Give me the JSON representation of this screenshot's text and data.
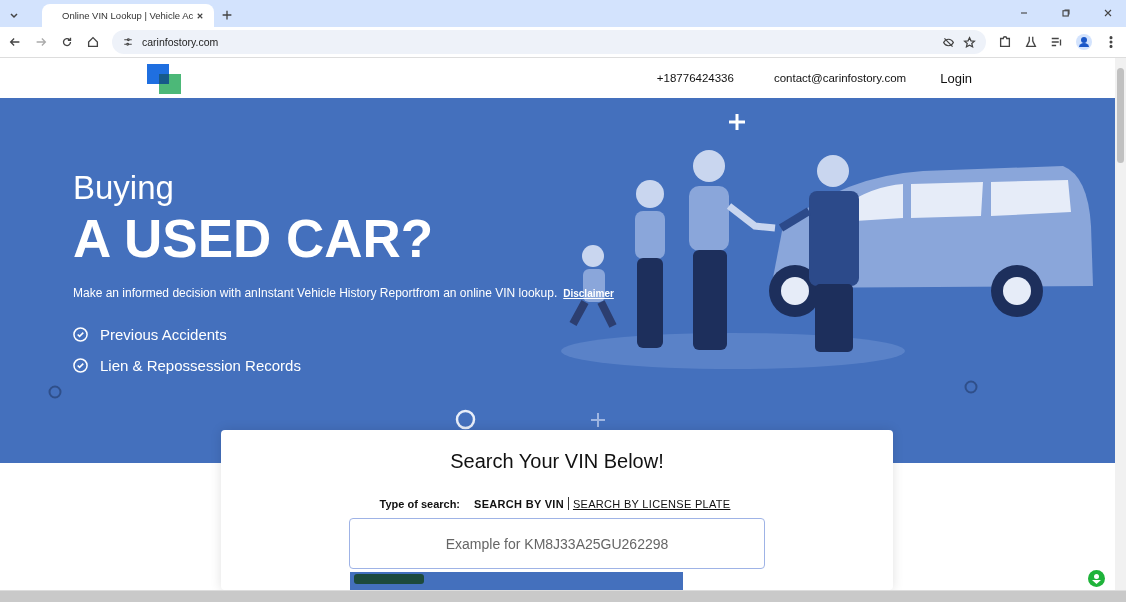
{
  "browser": {
    "tab_title": "Online VIN Lookup | Vehicle Ac",
    "address": "carinfostory.com"
  },
  "header": {
    "phone": "+18776424336",
    "email": "contact@carinfostory.com",
    "login": "Login"
  },
  "hero": {
    "kicker": "Buying",
    "headline": "A USED CAR?",
    "description": "Make an informed decision with anInstant Vehicle History Reportfrom an online VIN lookup.",
    "disclaimer": "Disclaimer",
    "features": [
      "Previous Accidents",
      "Lien & Repossession Records"
    ]
  },
  "search": {
    "title": "Search Your VIN Below!",
    "type_label": "Type of search:",
    "types": [
      {
        "label": "SEARCH BY VIN",
        "selected": true
      },
      {
        "label": "SEARCH BY LICENSE PLATE",
        "selected": false
      }
    ],
    "placeholder": "Example for KM8J33A25GU262298"
  }
}
